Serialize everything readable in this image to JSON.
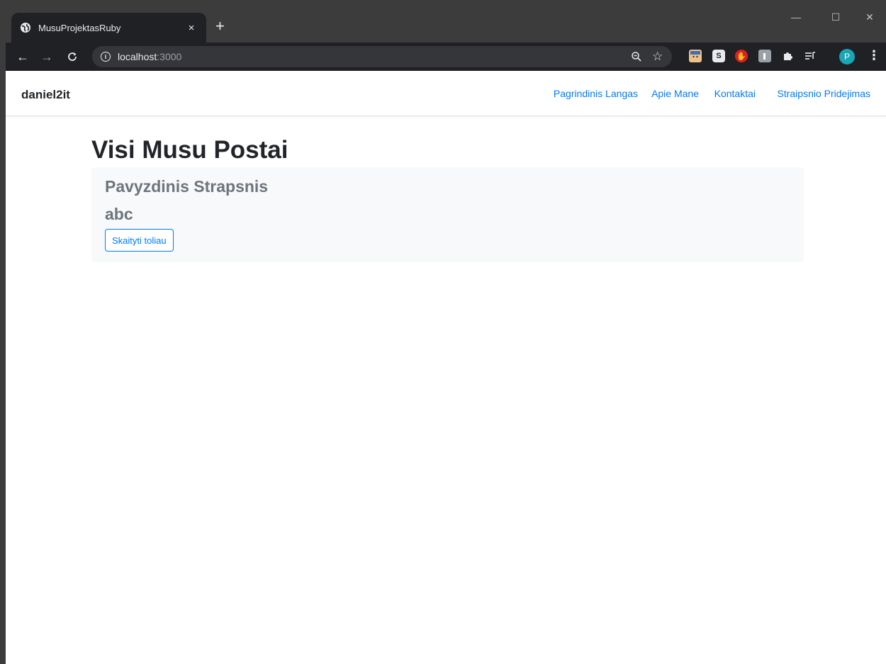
{
  "browser": {
    "tab": {
      "title": "MusuProjektasRuby",
      "close_glyph": "×"
    },
    "new_tab_glyph": "+",
    "url": {
      "host": "localhost",
      "port": ":3000"
    },
    "window_controls": {
      "minimize": "—",
      "maximize": "☐",
      "close": "✕"
    },
    "profile_initial": "P",
    "extensions": [
      "ext-face-icon",
      "ext-s-icon",
      "ext-stop-icon",
      "ext-touch-icon",
      "puzzle-icon",
      "media-icon"
    ],
    "extension_labels": {
      "s": "S"
    },
    "accent_color": "#1ba6b5"
  },
  "navbar": {
    "brand": "daniel2it",
    "links": [
      {
        "label": "Pagrindinis Langas"
      },
      {
        "label": "Apie Mane"
      },
      {
        "label": "Kontaktai"
      },
      {
        "label": "Straipsnio Pridejimas"
      }
    ],
    "link_color": "#007bff"
  },
  "main": {
    "heading": "Visi Musu Postai",
    "posts": [
      {
        "title": "Pavyzdinis Strapsnis",
        "body": "abc",
        "button": "Skaityti toliau"
      }
    ]
  }
}
